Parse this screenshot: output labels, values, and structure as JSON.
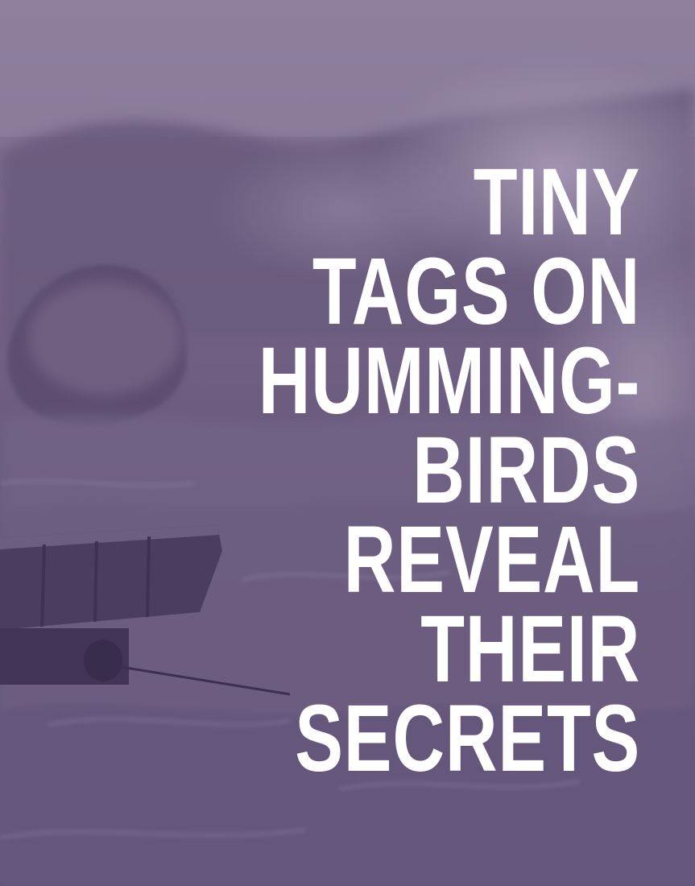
{
  "headline": {
    "lines": [
      "TINY",
      "TAGS ON",
      "HUMMING-",
      "BIRDS",
      "REVEAL",
      "THEIR",
      "SECRETS"
    ]
  },
  "photo": {
    "subject": "stormy sea with breaking waves and a cart at the shoreline",
    "tint_color": "#7a6a8c"
  }
}
